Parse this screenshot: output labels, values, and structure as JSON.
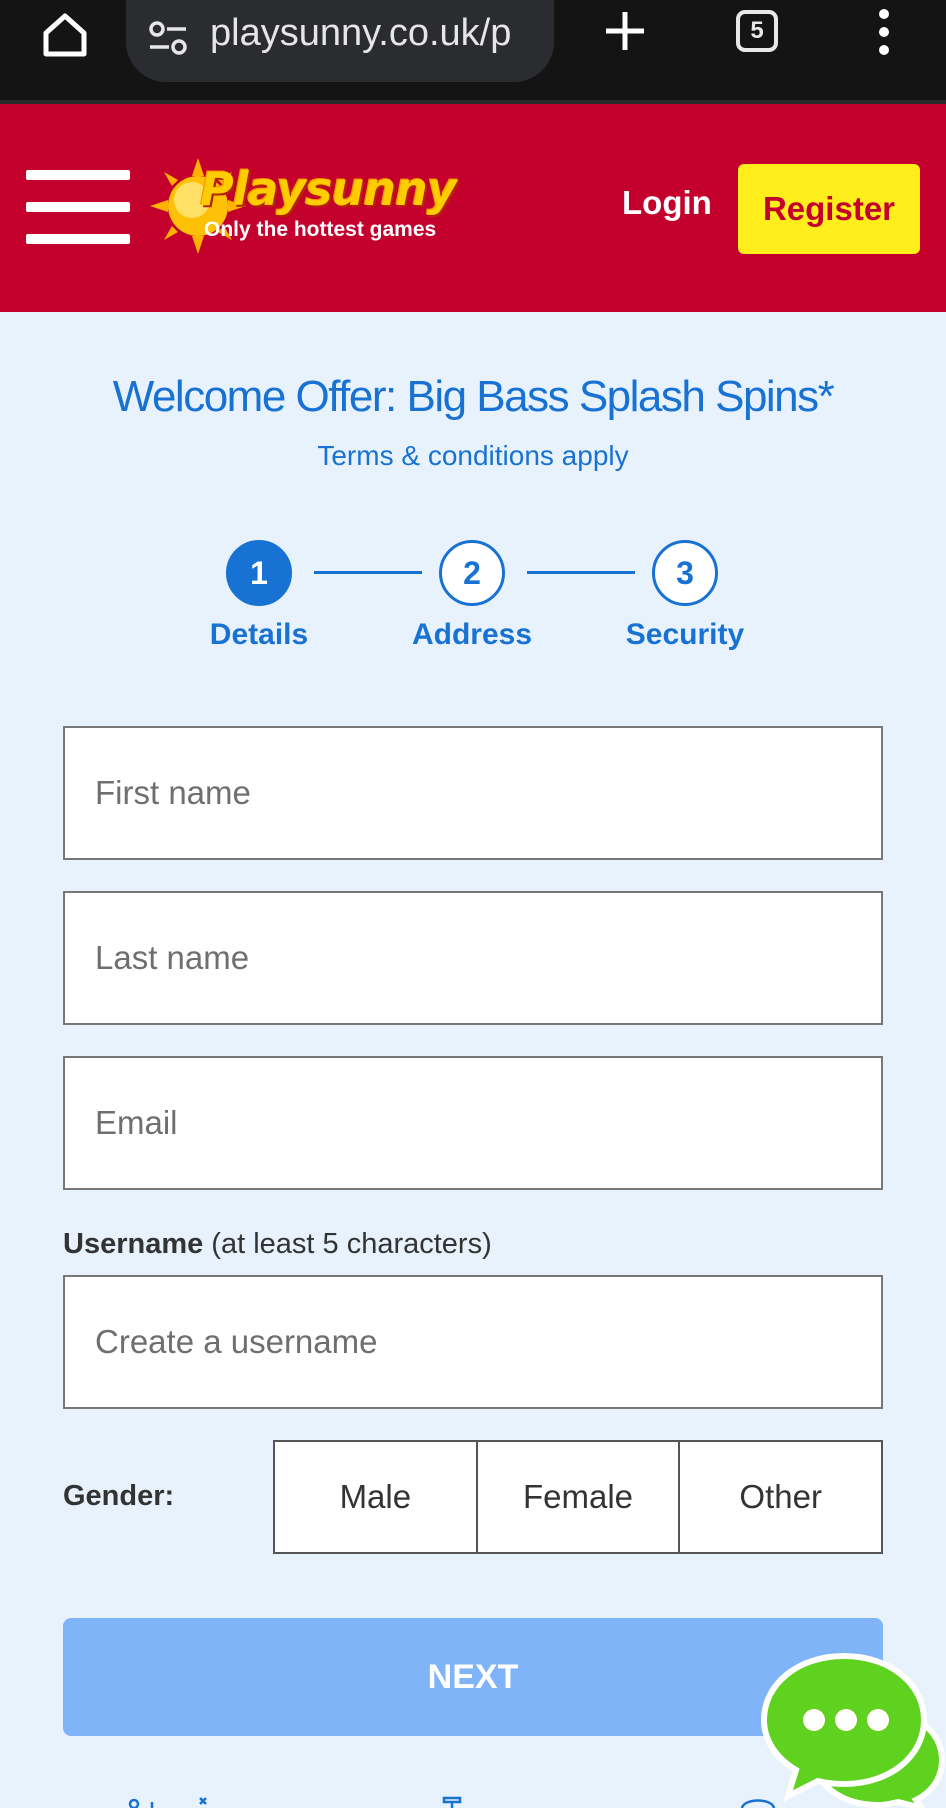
{
  "browser": {
    "url": "playsunny.co.uk/p",
    "tab_count": "5"
  },
  "header": {
    "logo_name": "Playsunny",
    "logo_tagline": "Only the hottest games",
    "login_label": "Login",
    "register_label": "Register"
  },
  "offer": {
    "title": "Welcome Offer: Big Bass Splash Spins*",
    "terms": "Terms & conditions apply"
  },
  "steps": [
    {
      "number": "1",
      "label": "Details",
      "active": true
    },
    {
      "number": "2",
      "label": "Address",
      "active": false
    },
    {
      "number": "3",
      "label": "Security",
      "active": false
    }
  ],
  "form": {
    "first_name_placeholder": "First name",
    "last_name_placeholder": "Last name",
    "email_placeholder": "Email",
    "username_label_bold": "Username",
    "username_label_hint": " (at least 5 characters)",
    "username_placeholder": "Create a username",
    "gender_label": "Gender:",
    "gender_options": [
      "Male",
      "Female",
      "Other"
    ],
    "next_label": "NEXT"
  },
  "colors": {
    "header_red": "#c4002d",
    "register_yellow": "#ffee1c",
    "accent_blue": "#1872d3",
    "next_disabled_blue": "#7fb4f8",
    "chat_green": "#5fd11f",
    "page_bg": "#e8f2fd"
  },
  "icons": {
    "home": "home-icon",
    "site_settings": "tune-icon",
    "new_tab": "plus-icon",
    "tab_switcher": "tabs-icon",
    "overflow": "more-vert-icon",
    "menu": "hamburger-icon",
    "logo_sun": "sun-icon",
    "chat": "chat-bubble-icon"
  }
}
